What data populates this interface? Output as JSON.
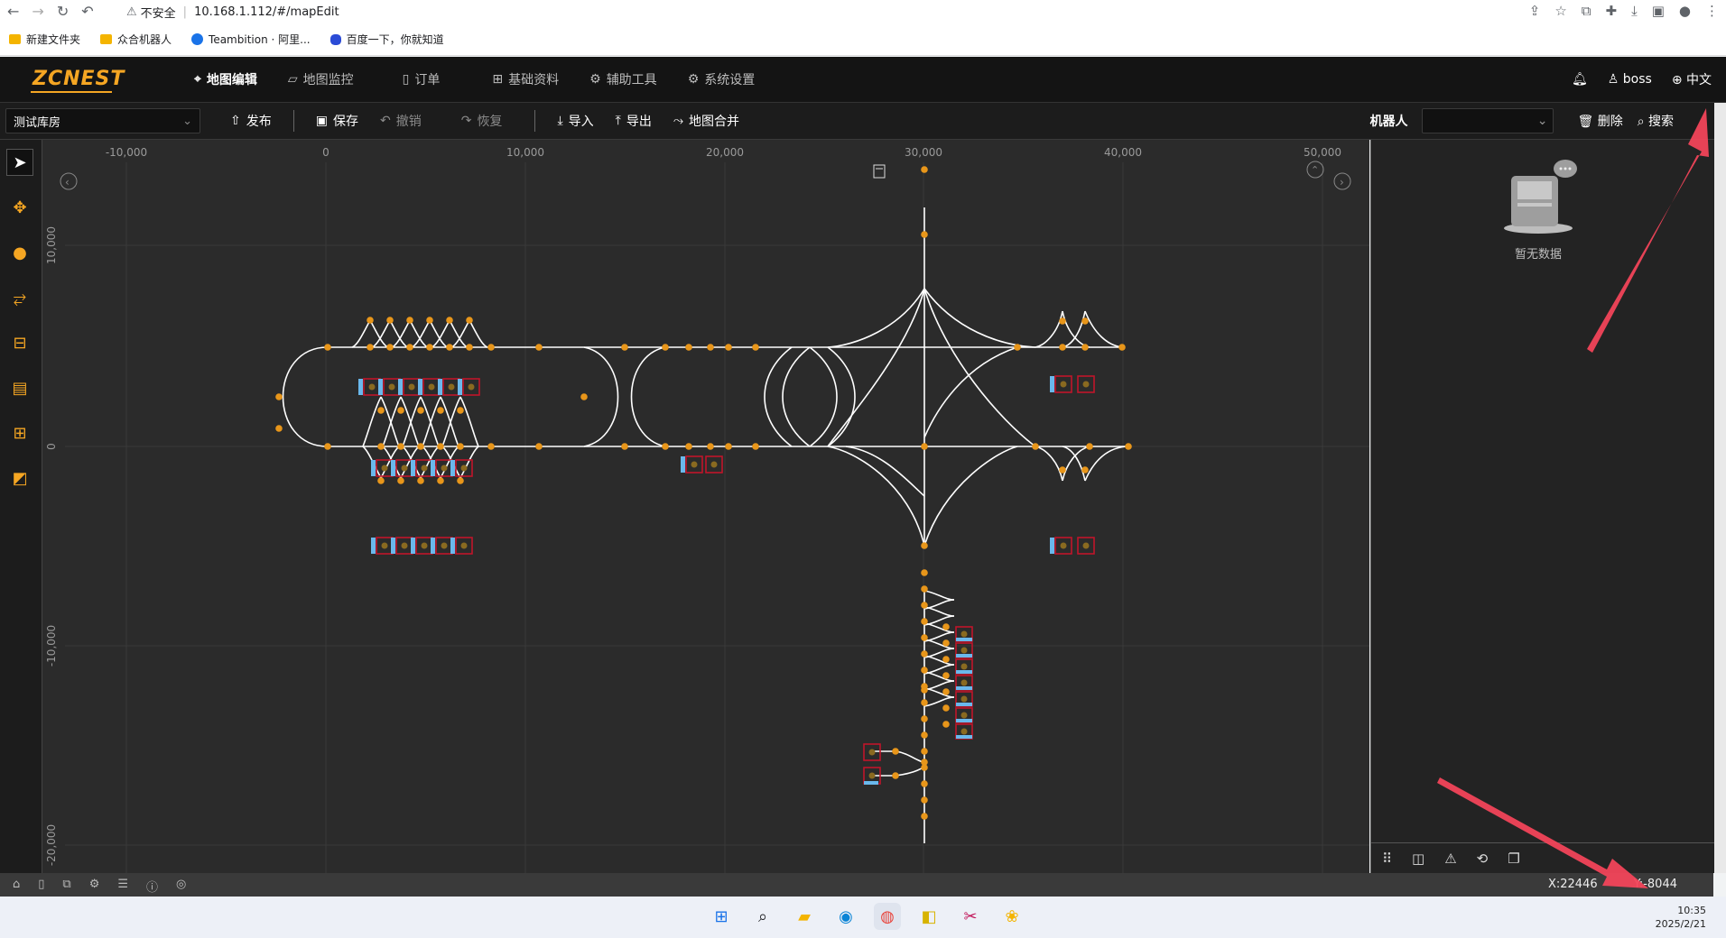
{
  "browser": {
    "security_label": "不安全",
    "url": "10.168.1.112/#/mapEdit",
    "bookmarks": [
      {
        "label": "新建文件夹",
        "icon": "folder-icon"
      },
      {
        "label": "众合机器人",
        "icon": "folder-icon"
      },
      {
        "label": "Teambition · 阿里...",
        "icon": "teambition-icon"
      },
      {
        "label": "百度一下，你就知道",
        "icon": "baidu-icon"
      }
    ]
  },
  "app": {
    "logo": "ZCNEST",
    "nav": [
      {
        "label": "地图编辑",
        "icon": "map-pin-icon",
        "active": true
      },
      {
        "label": "地图监控",
        "icon": "chart-icon",
        "active": false
      },
      {
        "label": "订单",
        "icon": "document-icon",
        "active": false
      },
      {
        "label": "基础资料",
        "icon": "sliders-icon",
        "active": false
      },
      {
        "label": "辅助工具",
        "icon": "gear-icon",
        "active": false
      },
      {
        "label": "系统设置",
        "icon": "gear-icon",
        "active": false
      }
    ],
    "user": "boss",
    "language": "中文"
  },
  "toolbar": {
    "warehouse": "测试库房",
    "actions": [
      {
        "label": "发布",
        "icon": "publish-icon",
        "enabled": true
      },
      {
        "label": "保存",
        "icon": "save-icon",
        "enabled": true
      },
      {
        "label": "撤销",
        "icon": "undo-icon",
        "enabled": false
      },
      {
        "label": "恢复",
        "icon": "redo-icon",
        "enabled": false
      },
      {
        "label": "导入",
        "icon": "import-icon",
        "enabled": true
      },
      {
        "label": "导出",
        "icon": "export-icon",
        "enabled": true
      },
      {
        "label": "地图合并",
        "icon": "merge-icon",
        "enabled": true
      }
    ],
    "robot_label": "机器人",
    "robot_value": "",
    "delete_label": "删除",
    "search_label": "搜索"
  },
  "map": {
    "x_ticks": [
      "-10,000",
      "0",
      "10,000",
      "20,000",
      "30,000",
      "40,000",
      "50,000"
    ],
    "y_ticks": [
      "10,000",
      "0",
      "-10,000",
      "-20,000"
    ]
  },
  "right_panel": {
    "empty_text": "暂无数据"
  },
  "status": {
    "x": "X:22446",
    "y": "Y:-8044"
  },
  "taskbar": {
    "time": "10:35",
    "date": "2025/2/21"
  },
  "colors": {
    "accent": "#f5a623",
    "node": "#e8961a",
    "edge": "#ffffff",
    "shelf_red": "#c0152a",
    "shelf_blue": "#6ab8ec",
    "annotation_arrow": "#f2455a"
  }
}
